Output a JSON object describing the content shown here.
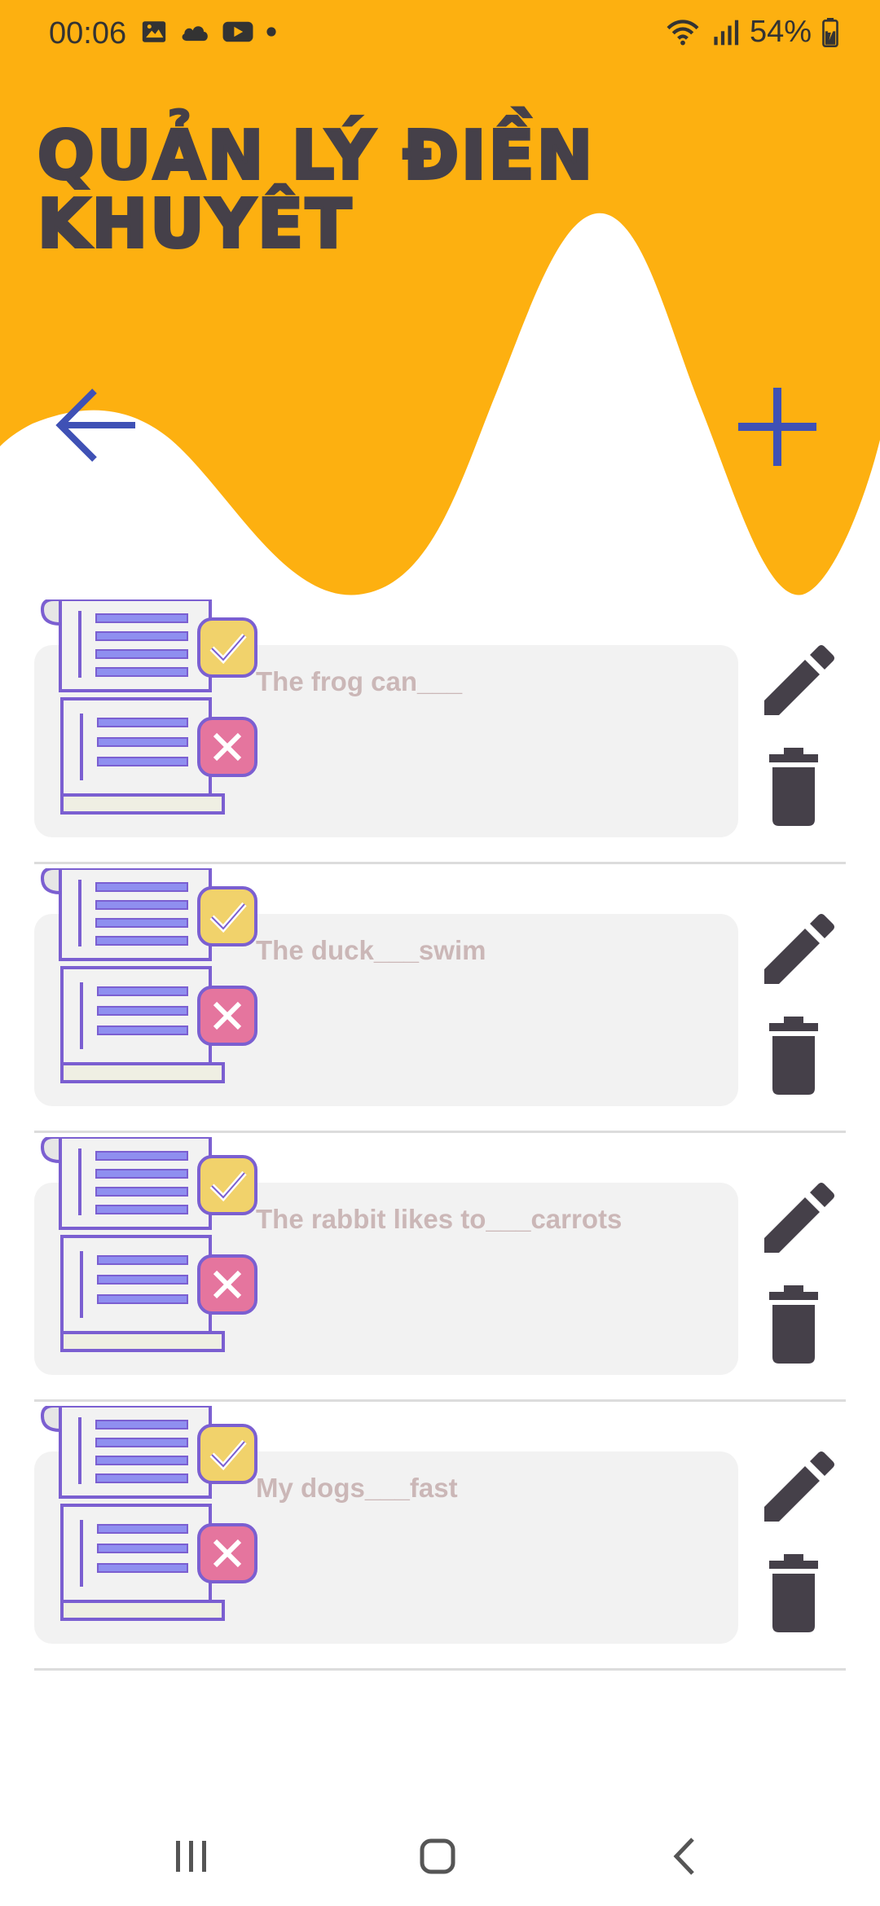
{
  "status_bar": {
    "time": "00:06",
    "battery": "54%",
    "icons_left": [
      "image-icon",
      "cloud-icon",
      "youtube-icon",
      "dot-icon"
    ],
    "icons_right": [
      "wifi-icon",
      "signal-icon",
      "battery-icon"
    ]
  },
  "header": {
    "title": "QUẢN LÝ ĐIỀN KHUYÊT",
    "accent_color": "#FDB010",
    "icon_color": "#3F51B5",
    "back_icon": "arrow-left-icon",
    "add_icon": "plus-icon"
  },
  "items": [
    {
      "text": "The frog can___"
    },
    {
      "text": "The duck___swim"
    },
    {
      "text": "The rabbit likes to___carrots"
    },
    {
      "text": "My dogs___fast"
    }
  ],
  "item_icons": {
    "illustration": "quiz-document-icon",
    "edit": "pencil-icon",
    "delete": "trash-icon"
  },
  "nav_bar": {
    "buttons": [
      "recent-apps-icon",
      "home-icon",
      "back-icon"
    ]
  }
}
